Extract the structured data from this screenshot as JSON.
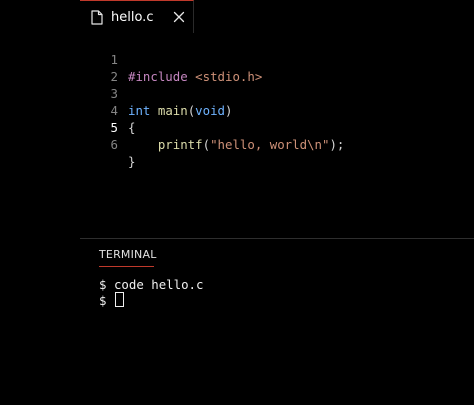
{
  "tab": {
    "filename": "hello.c",
    "file_icon": "file-icon",
    "close_icon": "close-icon"
  },
  "editor": {
    "active_line": 5,
    "lines": [
      {
        "number": "1",
        "text": "#include <stdio.h>"
      },
      {
        "number": "2",
        "text": ""
      },
      {
        "number": "3",
        "text": "int main(void)"
      },
      {
        "number": "4",
        "text": "{"
      },
      {
        "number": "5",
        "text": "    printf(\"hello, world\\n\");"
      },
      {
        "number": "6",
        "text": "}"
      }
    ]
  },
  "terminal": {
    "tab_label": "TERMINAL",
    "lines": [
      {
        "prompt": "$",
        "command": "code hello.c"
      },
      {
        "prompt": "$",
        "command": ""
      }
    ]
  },
  "colors": {
    "background": "#000000",
    "accent": "#c0392b",
    "line_number": "#858585",
    "keyword": "#6fb3ff",
    "text": "#d4d4d4"
  }
}
